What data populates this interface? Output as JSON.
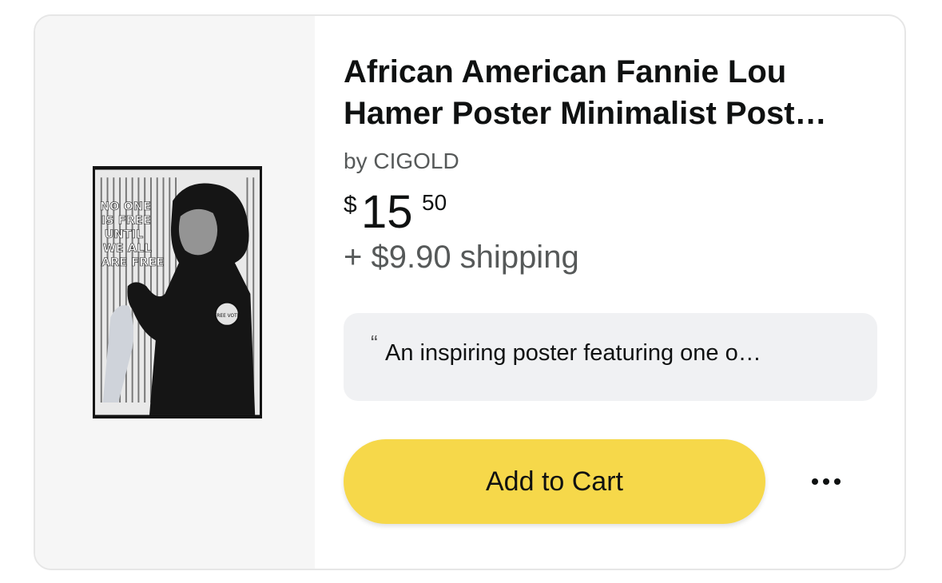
{
  "product": {
    "title_line1": "African American Fannie Lou",
    "title_line2": "Hamer Poster Minimalist Post…",
    "byline": "by CIGOLD",
    "price": {
      "symbol": "$",
      "whole": "15",
      "fraction": "50"
    },
    "shipping": "+ $9.90 shipping",
    "review_snippet": "An inspiring poster featuring one o…",
    "review_quote_mark": "“",
    "image": {
      "icon": "product-poster-image",
      "poster_text_lines": [
        "NO ONE",
        "IS FREE",
        "UNTIL",
        "WE ALL",
        "ARE FREE"
      ],
      "badge_text": "FREE VOTE"
    }
  },
  "actions": {
    "add_to_cart_label": "Add to Cart",
    "more_icon": "more-options-icon"
  },
  "colors": {
    "button": "#f6d84a",
    "review_bg": "#f0f1f3",
    "image_panel_bg": "#f6f6f6",
    "text_primary": "#0f1111",
    "text_secondary": "#565959"
  }
}
